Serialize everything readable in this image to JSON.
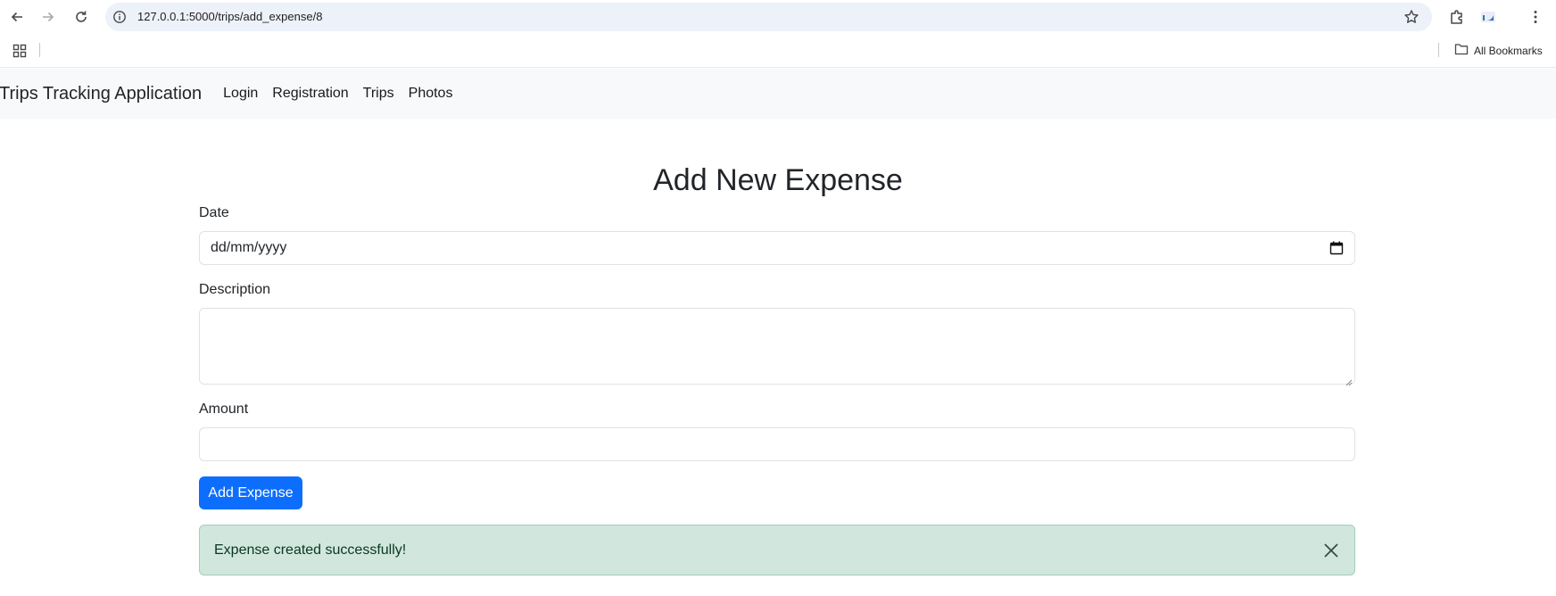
{
  "browser": {
    "url": "127.0.0.1:5000/trips/add_expense/8",
    "bookmarks_label": "All Bookmarks"
  },
  "navbar": {
    "brand": "Trips Tracking Application",
    "links": [
      "Login",
      "Registration",
      "Trips",
      "Photos"
    ]
  },
  "form": {
    "title": "Add New Expense",
    "date_label": "Date",
    "date_placeholder": "dd/mm/yyyy",
    "description_label": "Description",
    "description_value": "",
    "amount_label": "Amount",
    "amount_value": "",
    "submit_label": "Add Expense"
  },
  "alert": {
    "message": "Expense created successfully!",
    "type": "success"
  },
  "colors": {
    "primary": "#0d6efd",
    "success_bg": "#d1e7dd",
    "success_text": "#0a3622",
    "navbar_bg": "#f8f9fa"
  }
}
